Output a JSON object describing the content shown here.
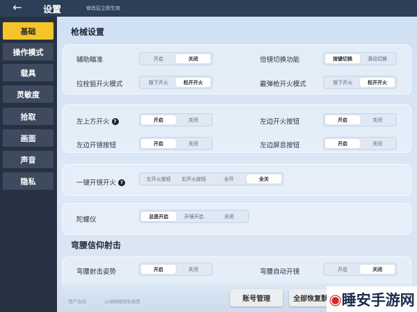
{
  "header": {
    "title": "设置",
    "note": "修改后立即生效"
  },
  "sidebar": {
    "items": [
      {
        "label": "基础",
        "active": true
      },
      {
        "label": "操作模式",
        "active": false
      },
      {
        "label": "载具",
        "active": false
      },
      {
        "label": "灵敏度",
        "active": false
      },
      {
        "label": "拾取",
        "active": false
      },
      {
        "label": "画面",
        "active": false
      },
      {
        "label": "声音",
        "active": false
      },
      {
        "label": "隐私",
        "active": false
      }
    ]
  },
  "sections": {
    "gun_settings": "枪械设置",
    "crouch_fire": "弯腰信仰射击"
  },
  "rows": {
    "aim_assist": {
      "label": "辅助瞄准",
      "options": [
        "开启",
        "关闭"
      ],
      "selected": 1
    },
    "scope_switch": {
      "label": "倍镜切换功能",
      "options": [
        "按键切换",
        "滑动切换"
      ],
      "selected": 0
    },
    "bolt_sniper": {
      "label": "拉栓狙开火模式",
      "options": [
        "按下开火",
        "松开开火"
      ],
      "selected": 1
    },
    "shotgun": {
      "label": "霰弹枪开火模式",
      "options": [
        "按下开火",
        "松开开火"
      ],
      "selected": 1
    },
    "top_left_fire": {
      "label": "左上方开火",
      "options": [
        "开启",
        "关闭"
      ],
      "selected": 0
    },
    "left_fire_btn": {
      "label": "左边开火按钮",
      "options": [
        "开启",
        "关闭"
      ],
      "selected": 0
    },
    "left_scope_btn": {
      "label": "左边开镜按钮",
      "options": [
        "开启",
        "关闭"
      ],
      "selected": 0
    },
    "left_breath_btn": {
      "label": "左边屏息按钮",
      "options": [
        "开启",
        "关闭"
      ],
      "selected": 0
    },
    "one_key_scope": {
      "label": "一键开镜开火",
      "options": [
        "左开火按钮",
        "右开火按钮",
        "全开",
        "全关"
      ],
      "selected": 3
    },
    "gyroscope": {
      "label": "陀螺仪",
      "options": [
        "总是开启",
        "开镜开启",
        "关闭"
      ],
      "selected": 0
    },
    "crouch_posture": {
      "label": "弯腰射击姿势",
      "options": [
        "开启",
        "关闭"
      ],
      "selected": 0
    },
    "crouch_auto_scope": {
      "label": "弯腰自动开镜",
      "options": [
        "开启",
        "关闭"
      ],
      "selected": 1
    }
  },
  "footer": {
    "user_agreement": "用户协议",
    "privacy_policy": "心动网络隐私政策",
    "account_button": "账号管理",
    "restore_button": "全部恢复默"
  },
  "watermark": {
    "text": "睡安手游网"
  },
  "colors": {
    "sidebar_bg": "#263244",
    "active_tab": "#f4c42a",
    "top_bar": "#2d3f56"
  },
  "icons": {
    "back": "arrow-left-icon",
    "help": "question-circle-icon"
  }
}
